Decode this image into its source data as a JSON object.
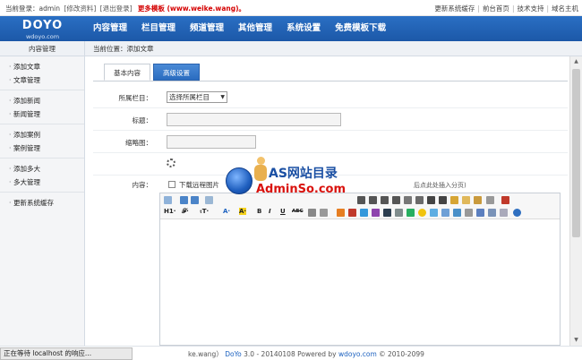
{
  "topbar": {
    "login_text": "当前登录：admin",
    "edit_profile": "[修改资料]",
    "logout": "[退出登录]",
    "promo": "更多模板 (www.weike.wang)。",
    "right_links": [
      "更新系统缓存",
      "前台首页",
      "技术支持",
      "域名主机"
    ]
  },
  "logo": {
    "brand": "DOYO",
    "sub": "wdoyo.com"
  },
  "nav": [
    "内容管理",
    "栏目管理",
    "频道管理",
    "其他管理",
    "系统设置",
    "免费模板下载"
  ],
  "subhead": {
    "side_title": "内容管理",
    "breadcrumb": "当前位置：添加文章"
  },
  "sidebar": {
    "groups": [
      [
        "添加文章",
        "文章管理"
      ],
      [
        "添加新闻",
        "新闻管理"
      ],
      [
        "添加案例",
        "案例管理"
      ],
      [
        "添加多大",
        "多大管理"
      ],
      [
        "更新系统缓存"
      ]
    ]
  },
  "tabs": {
    "basic": "基本内容",
    "advanced": "高级设置"
  },
  "form": {
    "column_label": "所属栏目：",
    "column_value": "选择所属栏目",
    "title_label": "标题：",
    "thumb_label": "缩略图：",
    "content_label": "内容：",
    "download_remote": "下载远程图片",
    "pagination_hint": "后点此处插入分页)"
  },
  "editor": {
    "heading_btn": "H1·",
    "font_btn": "𝓕·",
    "size_btn": "ₜT·",
    "font_color_btn": "A·",
    "bg_color_btn": "A·",
    "bold": "B",
    "italic": "I",
    "underline": "U",
    "strike": "ABC"
  },
  "watermark": {
    "line1": "AS网站目录",
    "line2": "AdminSo.com"
  },
  "footer": {
    "prefix": "ke.wang）",
    "product": "DoYo",
    "rest": " 3.0 - 20140108 Powered by ",
    "site": "wdoyo.com",
    "tail": " © 2010-2099"
  },
  "status": "正在等待 localhost 的响应..."
}
